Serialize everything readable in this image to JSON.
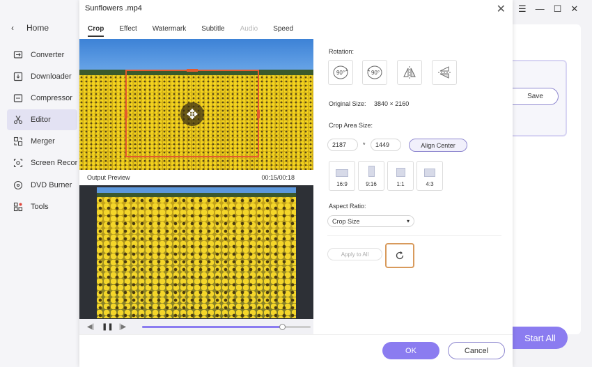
{
  "sidebar": {
    "home_label": "Home",
    "items": [
      {
        "label": "Converter",
        "icon": "converter-icon"
      },
      {
        "label": "Downloader",
        "icon": "downloader-icon"
      },
      {
        "label": "Compressor",
        "icon": "compressor-icon"
      },
      {
        "label": "Editor",
        "icon": "scissors-icon"
      },
      {
        "label": "Merger",
        "icon": "merger-icon"
      },
      {
        "label": "Screen Recorder",
        "icon": "screen-recorder-icon"
      },
      {
        "label": "DVD Burner",
        "icon": "dvd-icon"
      },
      {
        "label": "Tools",
        "icon": "tools-icon"
      }
    ]
  },
  "background": {
    "save_label": "Save",
    "start_all_label": "Start All"
  },
  "dialog": {
    "title": "Sunflowers .mp4",
    "tabs": [
      {
        "label": "Crop",
        "state": "active"
      },
      {
        "label": "Effect",
        "state": "normal"
      },
      {
        "label": "Watermark",
        "state": "normal"
      },
      {
        "label": "Subtitle",
        "state": "normal"
      },
      {
        "label": "Audio",
        "state": "disabled"
      },
      {
        "label": "Speed",
        "state": "normal"
      }
    ],
    "output_preview_label": "Output Preview",
    "time": "00:15/00:18",
    "progress_fraction": 0.83,
    "rotation_label": "Rotation:",
    "rotate_cw_label": "90°",
    "rotate_ccw_label": "90°",
    "original_size_label": "Original Size:",
    "original_size_value": "3840 × 2160",
    "crop_area_label": "Crop Area Size:",
    "crop_width": "2187",
    "crop_sep": "*",
    "crop_height": "1449",
    "align_center_label": "Align Center",
    "ratios": [
      "16:9",
      "9:16",
      "1:1",
      "4:3"
    ],
    "aspect_ratio_label": "Aspect Ratio:",
    "aspect_ratio_value": "Crop Size",
    "apply_all_label": "Apply to All",
    "ok_label": "OK",
    "cancel_label": "Cancel"
  },
  "colors": {
    "accent": "#8b7cf0",
    "crop_border": "#e45a2c"
  }
}
